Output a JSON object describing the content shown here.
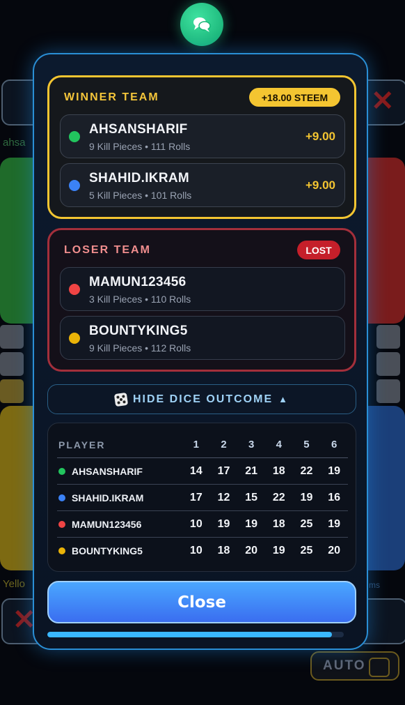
{
  "background": {
    "left_name_partial": "ahsa",
    "bottom_left_partial": "Yello",
    "bottom_right_partial": "ms",
    "auto_label": "AUTO"
  },
  "chat": {
    "icon": "chat-bubbles-icon"
  },
  "winner": {
    "title": "WINNER TEAM",
    "badge": "+18.00 STEEM",
    "players": [
      {
        "name": "AHSANSHARIF",
        "stats": "9 Kill Pieces • 111 Rolls",
        "score": "+9.00",
        "color": "#22c55e"
      },
      {
        "name": "SHAHID.IKRAM",
        "stats": "5 Kill Pieces • 101 Rolls",
        "score": "+9.00",
        "color": "#3b82f6"
      }
    ]
  },
  "loser": {
    "title": "LOSER TEAM",
    "badge": "LOST",
    "players": [
      {
        "name": "MAMUN123456",
        "stats": "3 Kill Pieces • 110 Rolls",
        "color": "#ef4444"
      },
      {
        "name": "BOUNTYKING5",
        "stats": "9 Kill Pieces • 112 Rolls",
        "color": "#eab308"
      }
    ]
  },
  "dice_toggle": {
    "label": "HIDE DICE OUTCOME",
    "arrow": "▲"
  },
  "dice_table": {
    "headers": [
      "PLAYER",
      "1",
      "2",
      "3",
      "4",
      "5",
      "6"
    ],
    "rows": [
      {
        "player": "AHSANSHARIF",
        "color": "#22c55e",
        "counts": [
          "14",
          "17",
          "21",
          "18",
          "22",
          "19"
        ]
      },
      {
        "player": "SHAHID.IKRAM",
        "color": "#3b82f6",
        "counts": [
          "17",
          "12",
          "15",
          "22",
          "19",
          "16"
        ]
      },
      {
        "player": "MAMUN123456",
        "color": "#ef4444",
        "counts": [
          "10",
          "19",
          "19",
          "18",
          "25",
          "19"
        ]
      },
      {
        "player": "BOUNTYKING5",
        "color": "#eab308",
        "counts": [
          "10",
          "18",
          "20",
          "19",
          "25",
          "20"
        ]
      }
    ]
  },
  "close_label": "Close",
  "progress_fraction": 0.96
}
